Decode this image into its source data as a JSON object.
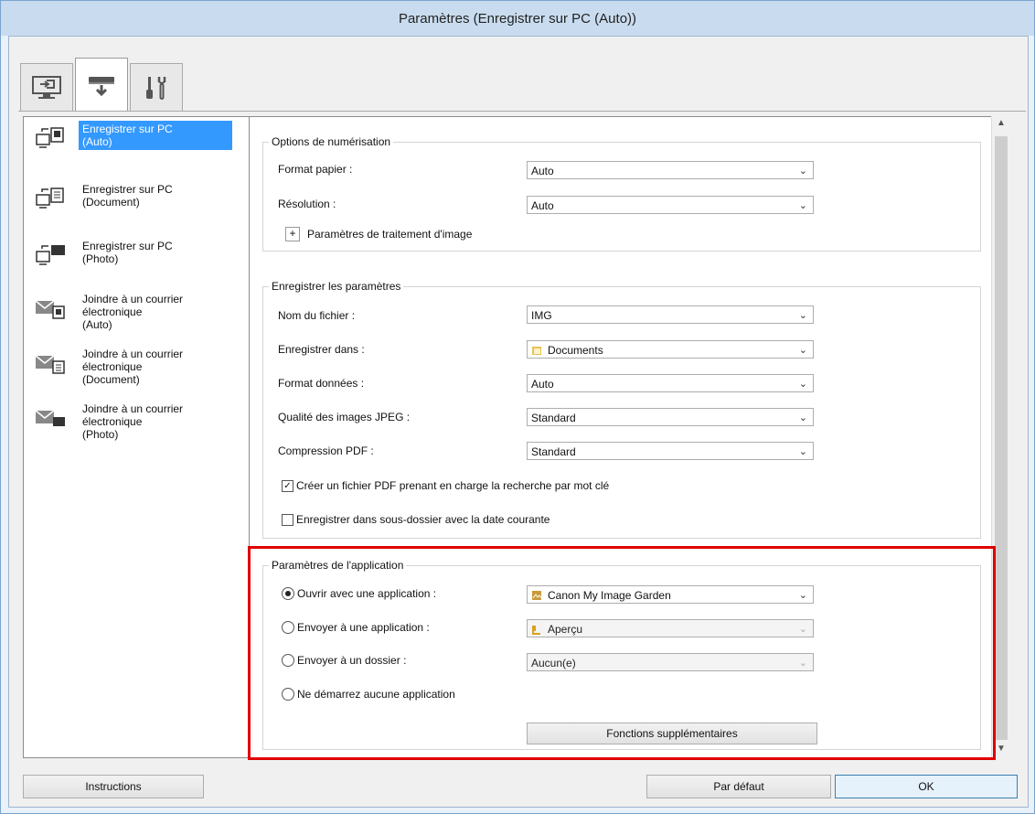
{
  "window": {
    "title": "Paramètres (Enregistrer sur PC (Auto))"
  },
  "tabs": [
    {
      "name": "scan-from-computer",
      "icon": "computer-scan-icon"
    },
    {
      "name": "scan-from-panel",
      "icon": "scanner-icon"
    },
    {
      "name": "general-settings",
      "icon": "tools-icon"
    }
  ],
  "sidebar": {
    "items": [
      {
        "label": "Enregistrer sur PC\n(Auto)",
        "selected": true
      },
      {
        "label": "Enregistrer sur PC\n(Document)"
      },
      {
        "label": "Enregistrer sur PC\n(Photo)"
      },
      {
        "label": "Joindre à un courrier\nélectronique\n(Auto)"
      },
      {
        "label": "Joindre à un courrier\nélectronique\n(Document)"
      },
      {
        "label": "Joindre à un courrier\nélectronique\n(Photo)"
      }
    ]
  },
  "scan_options": {
    "title": "Options de numérisation",
    "paper_size_label": "Format papier :",
    "paper_size_value": "Auto",
    "resolution_label": "Résolution :",
    "resolution_value": "Auto",
    "image_processing_label": "Paramètres de traitement d'image"
  },
  "save_settings": {
    "title": "Enregistrer les paramètres",
    "file_name_label": "Nom du fichier :",
    "file_name_value": "IMG",
    "save_in_label": "Enregistrer dans :",
    "save_in_value": "Documents",
    "data_format_label": "Format données :",
    "data_format_value": "Auto",
    "jpeg_quality_label": "Qualité des images JPEG :",
    "jpeg_quality_value": "Standard",
    "pdf_compression_label": "Compression PDF :",
    "pdf_compression_value": "Standard",
    "searchable_pdf_label": "Créer un fichier PDF prenant en charge la recherche par mot clé",
    "searchable_pdf_checked": true,
    "date_subfolder_label": "Enregistrer dans sous-dossier avec la date courante",
    "date_subfolder_checked": false
  },
  "app_settings": {
    "title": "Paramètres de l'application",
    "open_with_label": "Ouvrir avec une application :",
    "open_with_value": "Canon My Image Garden",
    "send_to_app_label": "Envoyer à une application :",
    "send_to_app_value": "Aperçu",
    "send_to_folder_label": "Envoyer à un dossier :",
    "send_to_folder_value": "Aucun(e)",
    "no_app_label": "Ne démarrez aucune application",
    "extra_functions_label": "Fonctions supplémentaires"
  },
  "footer": {
    "instructions_label": "Instructions",
    "defaults_label": "Par défaut",
    "ok_label": "OK"
  },
  "colors": {
    "selection": "#3399ff",
    "highlight_border": "#e00000"
  }
}
